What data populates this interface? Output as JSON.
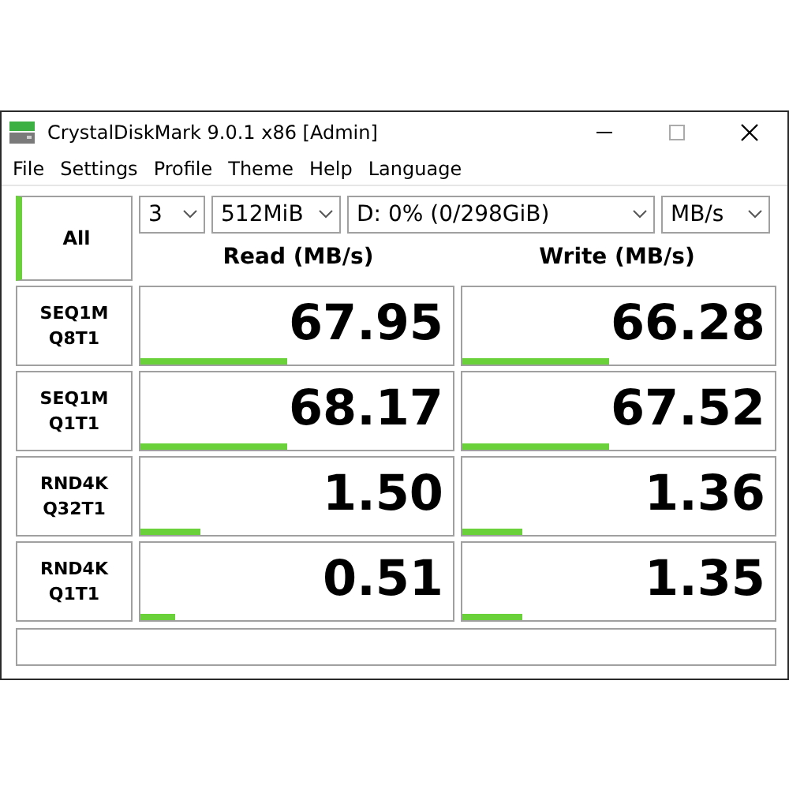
{
  "window": {
    "title": "CrystalDiskMark 9.0.1 x86 [Admin]"
  },
  "menu": [
    "File",
    "Settings",
    "Profile",
    "Theme",
    "Help",
    "Language"
  ],
  "all_button": {
    "label": "All"
  },
  "selectors": [
    {
      "value": "3"
    },
    {
      "value": "512MiB"
    },
    {
      "value": "D: 0% (0/298GiB)"
    },
    {
      "value": "MB/s"
    }
  ],
  "columns": [
    "Read (MB/s)",
    "Write (MB/s)"
  ],
  "tests": [
    {
      "name": [
        "SEQ1M",
        "Q8T1"
      ],
      "read": {
        "value": "67.95",
        "level": 0.47
      },
      "write": {
        "value": "66.28",
        "level": 0.47
      }
    },
    {
      "name": [
        "SEQ1M",
        "Q1T1"
      ],
      "read": {
        "value": "68.17",
        "level": 0.47
      },
      "write": {
        "value": "67.52",
        "level": 0.47
      }
    },
    {
      "name": [
        "RND4K",
        "Q32T1"
      ],
      "read": {
        "value": "1.50",
        "level": 0.19
      },
      "write": {
        "value": "1.36",
        "level": 0.19
      }
    },
    {
      "name": [
        "RND4K",
        "Q1T1"
      ],
      "read": {
        "value": "0.51",
        "level": 0.11
      },
      "write": {
        "value": "1.35",
        "level": 0.19
      }
    }
  ]
}
